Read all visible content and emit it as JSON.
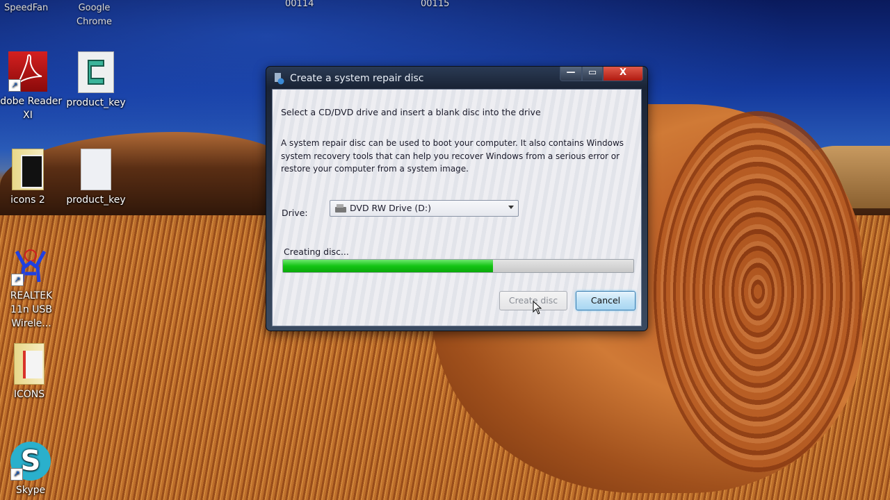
{
  "desktop": {
    "top_labels": [
      "SpeedFan",
      "Google\nChrome",
      "00114",
      "00115"
    ],
    "icons": [
      {
        "label": "Adobe Reader XI",
        "type": "pdf-app-icon",
        "shortcut": true
      },
      {
        "label": "product_key",
        "type": "script-file-icon",
        "shortcut": false
      },
      {
        "label": "icons 2",
        "type": "folder-icon",
        "shortcut": false
      },
      {
        "label": "product_key",
        "type": "text-file-icon",
        "shortcut": false
      },
      {
        "label": "REALTEK 11n USB Wirele...",
        "type": "wireless-utility-icon",
        "shortcut": true
      },
      {
        "label": "ICONS",
        "type": "folder-icon",
        "shortcut": false
      },
      {
        "label": "Skype",
        "type": "skype-icon",
        "shortcut": true
      }
    ]
  },
  "dialog": {
    "title": "Create a system repair disc",
    "window_buttons": {
      "minimize": "—",
      "maximize": "▭",
      "close": "X"
    },
    "heading": "Select a CD/DVD drive and insert a blank disc into the drive",
    "description": "A system repair disc can be used to boot your computer. It also contains Windows system recovery tools that can help you recover Windows from a serious error or restore your computer from a system image.",
    "drive_label": "Drive:",
    "drive_value": "DVD RW Drive (D:)",
    "status": "Creating disc...",
    "progress": 0.6,
    "create_button": "Create disc",
    "cancel_button": "Cancel",
    "colors": {
      "progress": "#14c414",
      "close": "#c8281c",
      "accent": "#3c7fb1"
    }
  }
}
